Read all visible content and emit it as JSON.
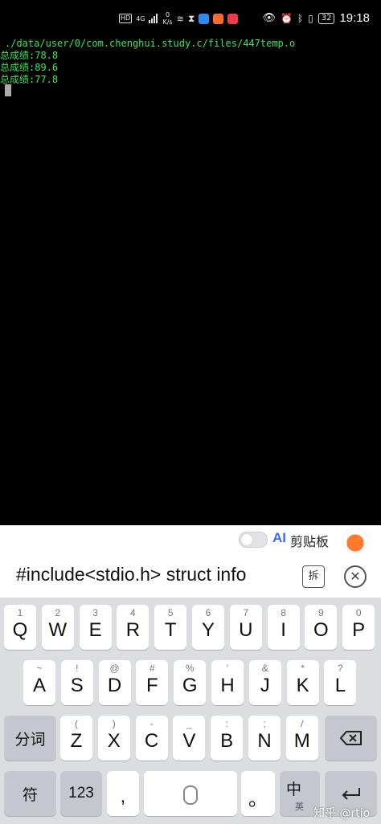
{
  "status_bar": {
    "hd": "HD",
    "signal": "4G",
    "speed_value": "0",
    "speed_unit": "K/s",
    "battery": "32",
    "time": "19:18"
  },
  "terminal": {
    "path_line": "./data/user/0/com.chenghui.study.c/files/447temp.o",
    "lines": [
      "总成绩:78.8",
      "总成绩:89.6",
      "总成绩:77.8"
    ]
  },
  "keyboard": {
    "toolbar": {
      "ai_label": "AI",
      "clipboard_label": "剪贴板"
    },
    "suggestion": "#include<stdio.h> struct info",
    "split_label": "拆",
    "row1": [
      {
        "k": "Q",
        "s": "1"
      },
      {
        "k": "W",
        "s": "2"
      },
      {
        "k": "E",
        "s": "3"
      },
      {
        "k": "R",
        "s": "4"
      },
      {
        "k": "T",
        "s": "5"
      },
      {
        "k": "Y",
        "s": "6"
      },
      {
        "k": "U",
        "s": "7"
      },
      {
        "k": "I",
        "s": "8"
      },
      {
        "k": "O",
        "s": "9"
      },
      {
        "k": "P",
        "s": "0"
      }
    ],
    "row2": [
      {
        "k": "A",
        "s": "~"
      },
      {
        "k": "S",
        "s": "!"
      },
      {
        "k": "D",
        "s": "@"
      },
      {
        "k": "F",
        "s": "#"
      },
      {
        "k": "G",
        "s": "%"
      },
      {
        "k": "H",
        "s": "'"
      },
      {
        "k": "J",
        "s": "&"
      },
      {
        "k": "K",
        "s": "*"
      },
      {
        "k": "L",
        "s": "?"
      }
    ],
    "row3": [
      {
        "k": "Z",
        "s": "("
      },
      {
        "k": "X",
        "s": ")"
      },
      {
        "k": "C",
        "s": "-"
      },
      {
        "k": "V",
        "s": "_"
      },
      {
        "k": "B",
        "s": ":"
      },
      {
        "k": "N",
        "s": ";"
      },
      {
        "k": "M",
        "s": "/"
      }
    ],
    "fenci": "分词",
    "fu": "符",
    "num": "123",
    "comma": ",",
    "period": "。",
    "zh": "中",
    "en": "英",
    "backspace_icon": "backspace-icon",
    "enter_icon": "enter-icon"
  },
  "watermark": "知乎 @rtio"
}
